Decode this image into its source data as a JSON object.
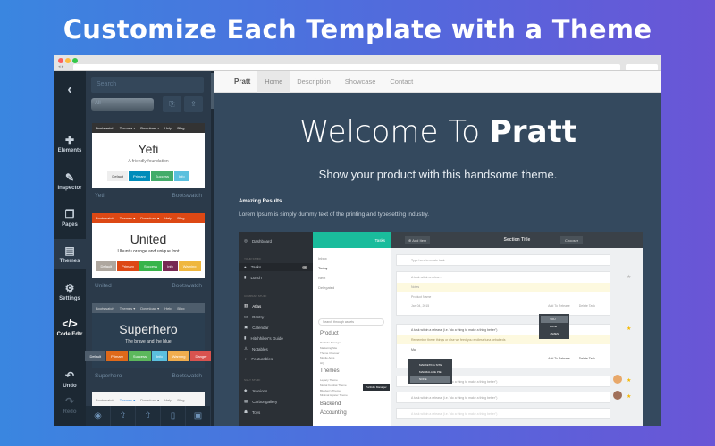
{
  "headline": "Customize Each Template with a Theme",
  "colors": {
    "bg_start": "#3a86e0",
    "bg_end": "#6a55d6",
    "rail": "#1c2833",
    "panel": "#2b3a4a",
    "hero": "#34495e",
    "teal": "#1abc9c"
  },
  "rail": {
    "back_icon": "chevron-left-icon",
    "items": [
      {
        "label": "Elements",
        "icon": "puzzle-icon"
      },
      {
        "label": "Inspector",
        "icon": "brush-icon"
      },
      {
        "label": "Pages",
        "icon": "pages-icon"
      },
      {
        "label": "Themes",
        "icon": "themes-icon"
      },
      {
        "label": "Settings",
        "icon": "gear-icon"
      },
      {
        "label": "Code Edtr",
        "icon": "code-icon"
      },
      {
        "label": "Undo",
        "icon": "undo-icon"
      },
      {
        "label": "Redo",
        "icon": "redo-icon"
      }
    ]
  },
  "panel": {
    "search_placeholder": "Search",
    "filter": "All",
    "themes": [
      {
        "nav_brand": "Bootswatch",
        "nav": [
          "Themes ▾",
          "Download ▾",
          "Help",
          "Blog"
        ],
        "title": "Yeti",
        "subtitle": "A friendly foundation",
        "buttons": [
          "Default",
          "Primary",
          "Success",
          "Info"
        ],
        "name": "Yeti",
        "source": "Bootswatch"
      },
      {
        "nav_brand": "Bootswatch",
        "nav": [
          "Themes ▾",
          "Download ▾",
          "Help",
          "Blog"
        ],
        "title": "United",
        "subtitle": "Ubuntu orange and unique font",
        "buttons": [
          "Default",
          "Primary",
          "Success",
          "Info",
          "Warning"
        ],
        "name": "United",
        "source": "Bootswatch"
      },
      {
        "nav_brand": "Bootswatch",
        "nav": [
          "Themes ▾",
          "Download ▾",
          "Help",
          "Blog"
        ],
        "title": "Superhero",
        "subtitle": "The brave and the blue",
        "buttons": [
          "Default",
          "Primary",
          "Success",
          "Info",
          "Warning",
          "Danger"
        ],
        "name": "Superhero",
        "source": "Bootswatch"
      },
      {
        "nav_brand": "Bootswatch",
        "nav": [
          "Themes ▾",
          "Download ▾",
          "Help",
          "Blog"
        ]
      }
    ]
  },
  "bottom_icons": [
    "eye-icon",
    "share-icon",
    "upload-icon",
    "mobile-icon",
    "save-icon"
  ],
  "site": {
    "brand": "Pratt",
    "nav": [
      "Home",
      "Description",
      "Showcase",
      "Contact"
    ],
    "hero_light": "Welcome To ",
    "hero_bold": "Pratt",
    "tagline": "Show your product with this handsome theme.",
    "section_title": "Amazing Results",
    "section_text": "Lorem Ipsum is simply dummy text of the printing and typesetting industry."
  },
  "app": {
    "sidebar": {
      "dashboard": "Dashboard",
      "your_stuff": "YOUR STUFF",
      "tasks": "Tasks",
      "tasks_count": "8",
      "lunch": "Lunch",
      "company_stuff": "COMPANY STUFF",
      "company": [
        "Atlas",
        "Pantry",
        "Calendar",
        "Hitchhiker's Guide",
        "Notables",
        "Featurables"
      ],
      "silly_stuff": "SILLY STUFF",
      "silly": [
        "Jsonions",
        "Carbongallery",
        "Toys"
      ]
    },
    "middle": {
      "header": "Tasks",
      "filters": [
        "Inbox",
        "Today",
        "Next",
        "Delegated"
      ],
      "search_placeholder": "Search through assets",
      "product": "Product",
      "product_items": [
        "Portfolio Manager",
        "Marketing Site",
        "Theme Chooser",
        "Mobile Apps",
        "HQ"
      ],
      "themes": "Themes",
      "theme_items": [
        "Legacy Theme",
        "Mortal Kombat Theme",
        "Blueberry Theme",
        "Minimal Hipster Theme"
      ],
      "backend": "Backend",
      "accounting": "Accounting",
      "tooltip": "Portfolio Manager"
    },
    "right": {
      "add_item": "Add Item",
      "title": "Section Title",
      "chooser": "Chooser",
      "new_task_placeholder": "Type here to create task",
      "task1": "A task within a relea...",
      "notes": "Notes",
      "product_name": "Product Name",
      "date": "Jan 04, 2015",
      "task_long": "A task within a release (i.e. \"do a thing to make a thing better\")",
      "remember": "Remember these things or else we feed you endless tuna kebabeds",
      "add_to_release": "Add To Release",
      "delete_task": "Delete Task",
      "assignees": [
        "YOU",
        "DAVE",
        "JAMES"
      ],
      "releases": [
        "MARKETING SITE",
        "MARMALADE PIE",
        "NONE"
      ],
      "typed": "Ma"
    }
  }
}
